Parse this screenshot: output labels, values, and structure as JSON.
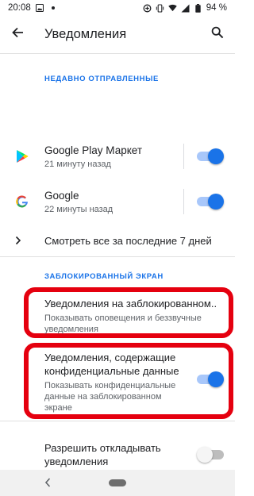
{
  "status_bar": {
    "time": "20:08",
    "battery": "94 %"
  },
  "app_bar": {
    "title": "Уведомления"
  },
  "recent": {
    "header": "НЕДАВНО ОТПРАВЛЕННЫЕ",
    "apps": [
      {
        "name": "Google Play Маркет",
        "time": "21 минуту назад",
        "enabled": true
      },
      {
        "name": "Google",
        "time": "22 минуты назад",
        "enabled": true
      }
    ],
    "see_all": "Смотреть все за последние 7 дней"
  },
  "lock_screen": {
    "header": "ЗАБЛОКИРОВАННЫЙ ЭКРАН",
    "on_lock_screen": {
      "title": "Уведомления на заблокированном..",
      "summary_line1": "Показывать оповещения и беззвучные",
      "summary_line2": "уведомления"
    },
    "sensitive": {
      "title_line1": "Уведомления, содержащие",
      "title_line2": "конфиденциальные данные",
      "summary_line1": "Показывать конфиденциальные",
      "summary_line2": "данные на заблокированном",
      "summary_line3": "экране",
      "enabled": true
    }
  },
  "snooze": {
    "title_line1": "Разрешить откладывать",
    "title_line2": "уведомления",
    "enabled": false
  },
  "colors": {
    "accent": "#1a73e8",
    "highlight": "#e5000f"
  }
}
